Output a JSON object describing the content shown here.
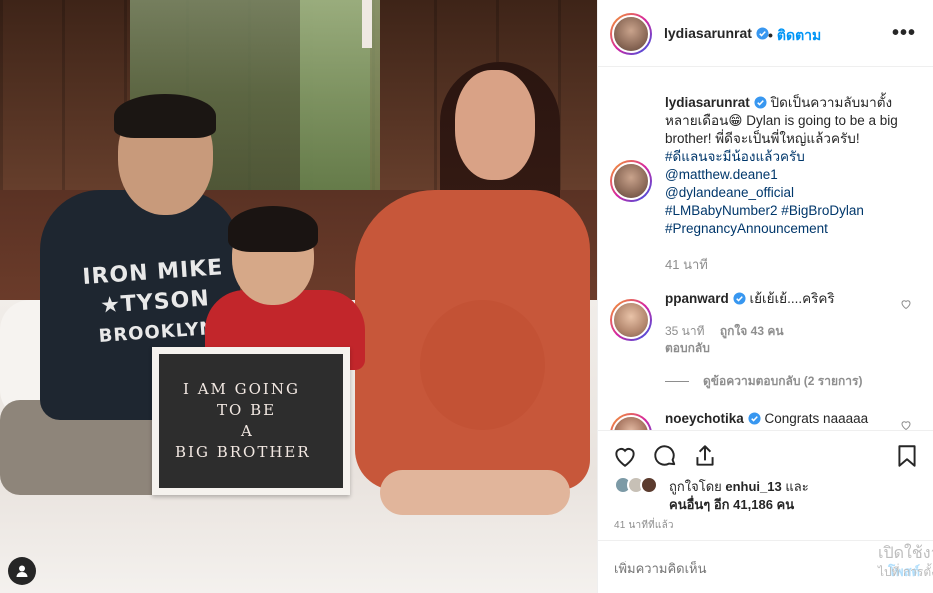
{
  "post": {
    "username": "lydiasarunrat",
    "follow_label": "ติดตาม",
    "follow_separator": "•",
    "more_label": "•••",
    "letterboard_lines": [
      "I AM GOING",
      "TO BE",
      "A",
      "BIG BROTHER"
    ],
    "shirt_text_lines": [
      "IRON MIKE",
      "★TYSON",
      "BROOKLYN"
    ]
  },
  "caption": {
    "username": "lydiasarunrat",
    "text": " ปิดเป็นความลับมาตั้งหลายเดือน😁 Dylan is going to be a big brother! พี่ดีจะเป็นพี่ใหญ่แล้วครับ!",
    "tags": [
      "#ดีแลนจะมีน้องแล้วครับ",
      "@matthew.deane1",
      "@dylandeane_official",
      "#LMBabyNumber2 #BigBroDylan",
      "#PregnancyAnnouncement"
    ],
    "time": "41 นาที"
  },
  "comments": [
    {
      "username": "ppanward",
      "text": " เย้เย้เย้....คริคริ",
      "time": "35 นาที",
      "likes": "ถูกใจ 43 คน",
      "reply": "ตอบกลับ"
    },
    {
      "username": "noeychotika",
      "text": " Congrats naaaaa"
    }
  ],
  "view_replies": "ดูข้อความตอบกลับ (2 รายการ)",
  "likes": {
    "prefix": "ถูกใจโดย ",
    "by": "enhui_13",
    "mid": " และ",
    "others": "คนอื่นๆ อีก 41,186 คน"
  },
  "timestamp": "41 นาทีที่แล้ว",
  "add_comment": {
    "placeholder": "เพิ่มความคิดเห็น",
    "post_label": "โพสต์"
  },
  "watermark": {
    "line1": "เปิดใช้งาน",
    "line2": "ไปที่ การตั้งค่า"
  },
  "icons": {
    "verified": "verified-badge-icon",
    "heart": "heart-icon",
    "comment": "comment-icon",
    "share": "share-icon",
    "bookmark": "bookmark-icon",
    "user": "user-tag-icon"
  },
  "colors": {
    "link": "#00376b",
    "follow": "#0095f6",
    "muted": "#8e8e8e",
    "verified": "#3897f0"
  }
}
